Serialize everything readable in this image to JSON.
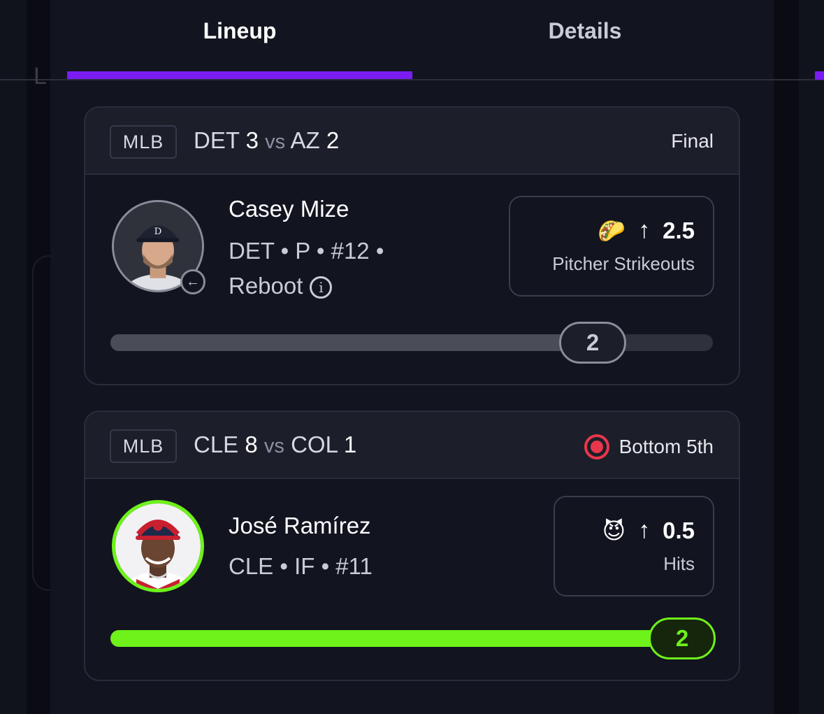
{
  "tabs": [
    {
      "label": "Lineup",
      "active": true
    },
    {
      "label": "Details",
      "active": false
    }
  ],
  "background_hint_letter": "L",
  "colors": {
    "accent": "#7b1cf2",
    "success": "#6ef21a",
    "live": "#e8374a",
    "neutral_progress": "#4a4c58"
  },
  "cards": [
    {
      "league": "MLB",
      "home_team": "DET",
      "home_score": "3",
      "vs": "vs",
      "away_team": "AZ",
      "away_score": "2",
      "status": "Final",
      "live": false,
      "player_name": "Casey Mize",
      "player_meta": "DET • P • #12 •",
      "player_tag": "Reboot",
      "avatar_icon": "player-photo-tigers",
      "badge_icon": "swap-icon",
      "projection_emoji": "🌮",
      "projection_direction_icon": "arrow-up-icon",
      "projection_value": "2.5",
      "projection_label": "Pitcher Strikeouts",
      "current_value": "2",
      "progress_fraction": 0.78
    },
    {
      "league": "MLB",
      "home_team": "CLE",
      "home_score": "8",
      "vs": "vs",
      "away_team": "COL",
      "away_score": "1",
      "status": "Bottom 5th",
      "live": true,
      "player_name": "José Ramírez",
      "player_meta": "CLE • IF • #11",
      "avatar_icon": "player-photo-guardians",
      "projection_emoji": "😈",
      "projection_direction_icon": "arrow-up-icon",
      "projection_value": "0.5",
      "projection_label": "Hits",
      "current_value": "2",
      "progress_fraction": 1.0
    }
  ]
}
